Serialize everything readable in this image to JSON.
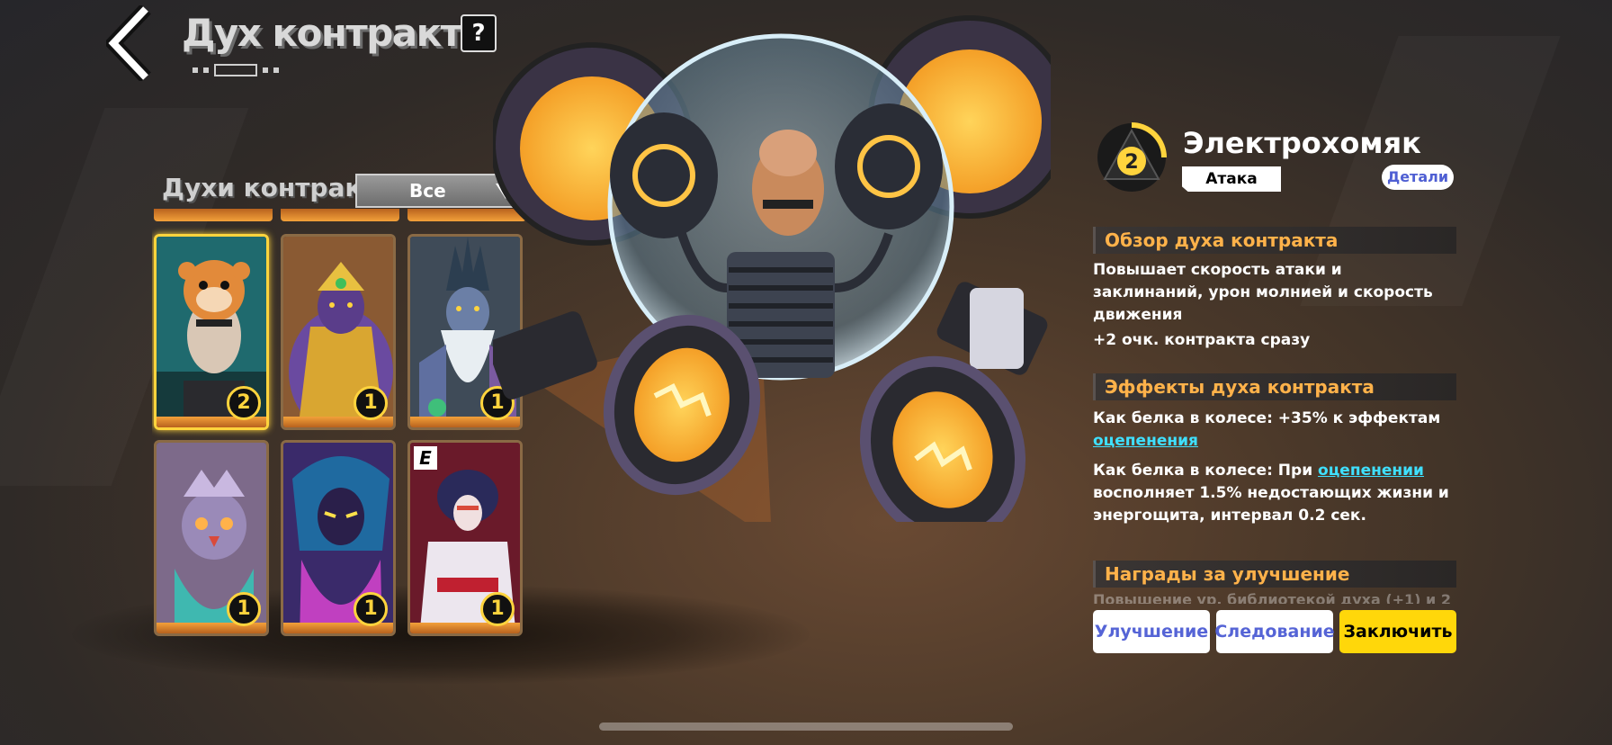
{
  "header": {
    "title": "Дух контракта",
    "help_label": "?"
  },
  "spirit_list": {
    "title": "Духи контракт",
    "filter_value": "Все",
    "cards": [
      {
        "name": "electro-hamster",
        "level": "2",
        "selected": true,
        "rank": ""
      },
      {
        "name": "golden-ape",
        "level": "1",
        "selected": false,
        "rank": ""
      },
      {
        "name": "ice-wizard",
        "level": "1",
        "selected": false,
        "rank": ""
      },
      {
        "name": "owl-spirit",
        "level": "1",
        "selected": false,
        "rank": ""
      },
      {
        "name": "shadow-sorceress",
        "level": "1",
        "selected": false,
        "rank": ""
      },
      {
        "name": "crimson-samurai",
        "level": "1",
        "selected": false,
        "rank": "E"
      }
    ]
  },
  "spirit_detail": {
    "name": "Электрохомяк",
    "rank_level": "2",
    "type": "Атака",
    "details_label": "Детали",
    "overview_title": "Обзор духа контракта",
    "overview_text": "Повышает скорость атаки и заклинаний, урон молнией и скорость движения",
    "overview_bonus": "+2 очк. контракта сразу",
    "effects_title": "Эффекты духа контракта",
    "effect1_prefix": "Как белка в колесе: +35% к эффектам",
    "effect1_link": "оцепенения",
    "effect2_prefix": "Как белка в колесе: При",
    "effect2_link": "оцепенении",
    "effect2_suffix": "восполняет 1.5% недостающих жизни и энергощита, интервал 0.2 сек.",
    "rewards_title": "Награды за улучшение",
    "rewards_faded": "Повышение ур. библиотекой духа (+1) и 2"
  },
  "actions": {
    "upgrade_label": "Улучшение",
    "follow_label": "Следование",
    "contract_label": "Заключить"
  },
  "colors": {
    "accent_yellow": "#ffd70a",
    "section_title": "#ffb24a",
    "link": "#3fe0ff",
    "button_text": "#5564d6"
  }
}
